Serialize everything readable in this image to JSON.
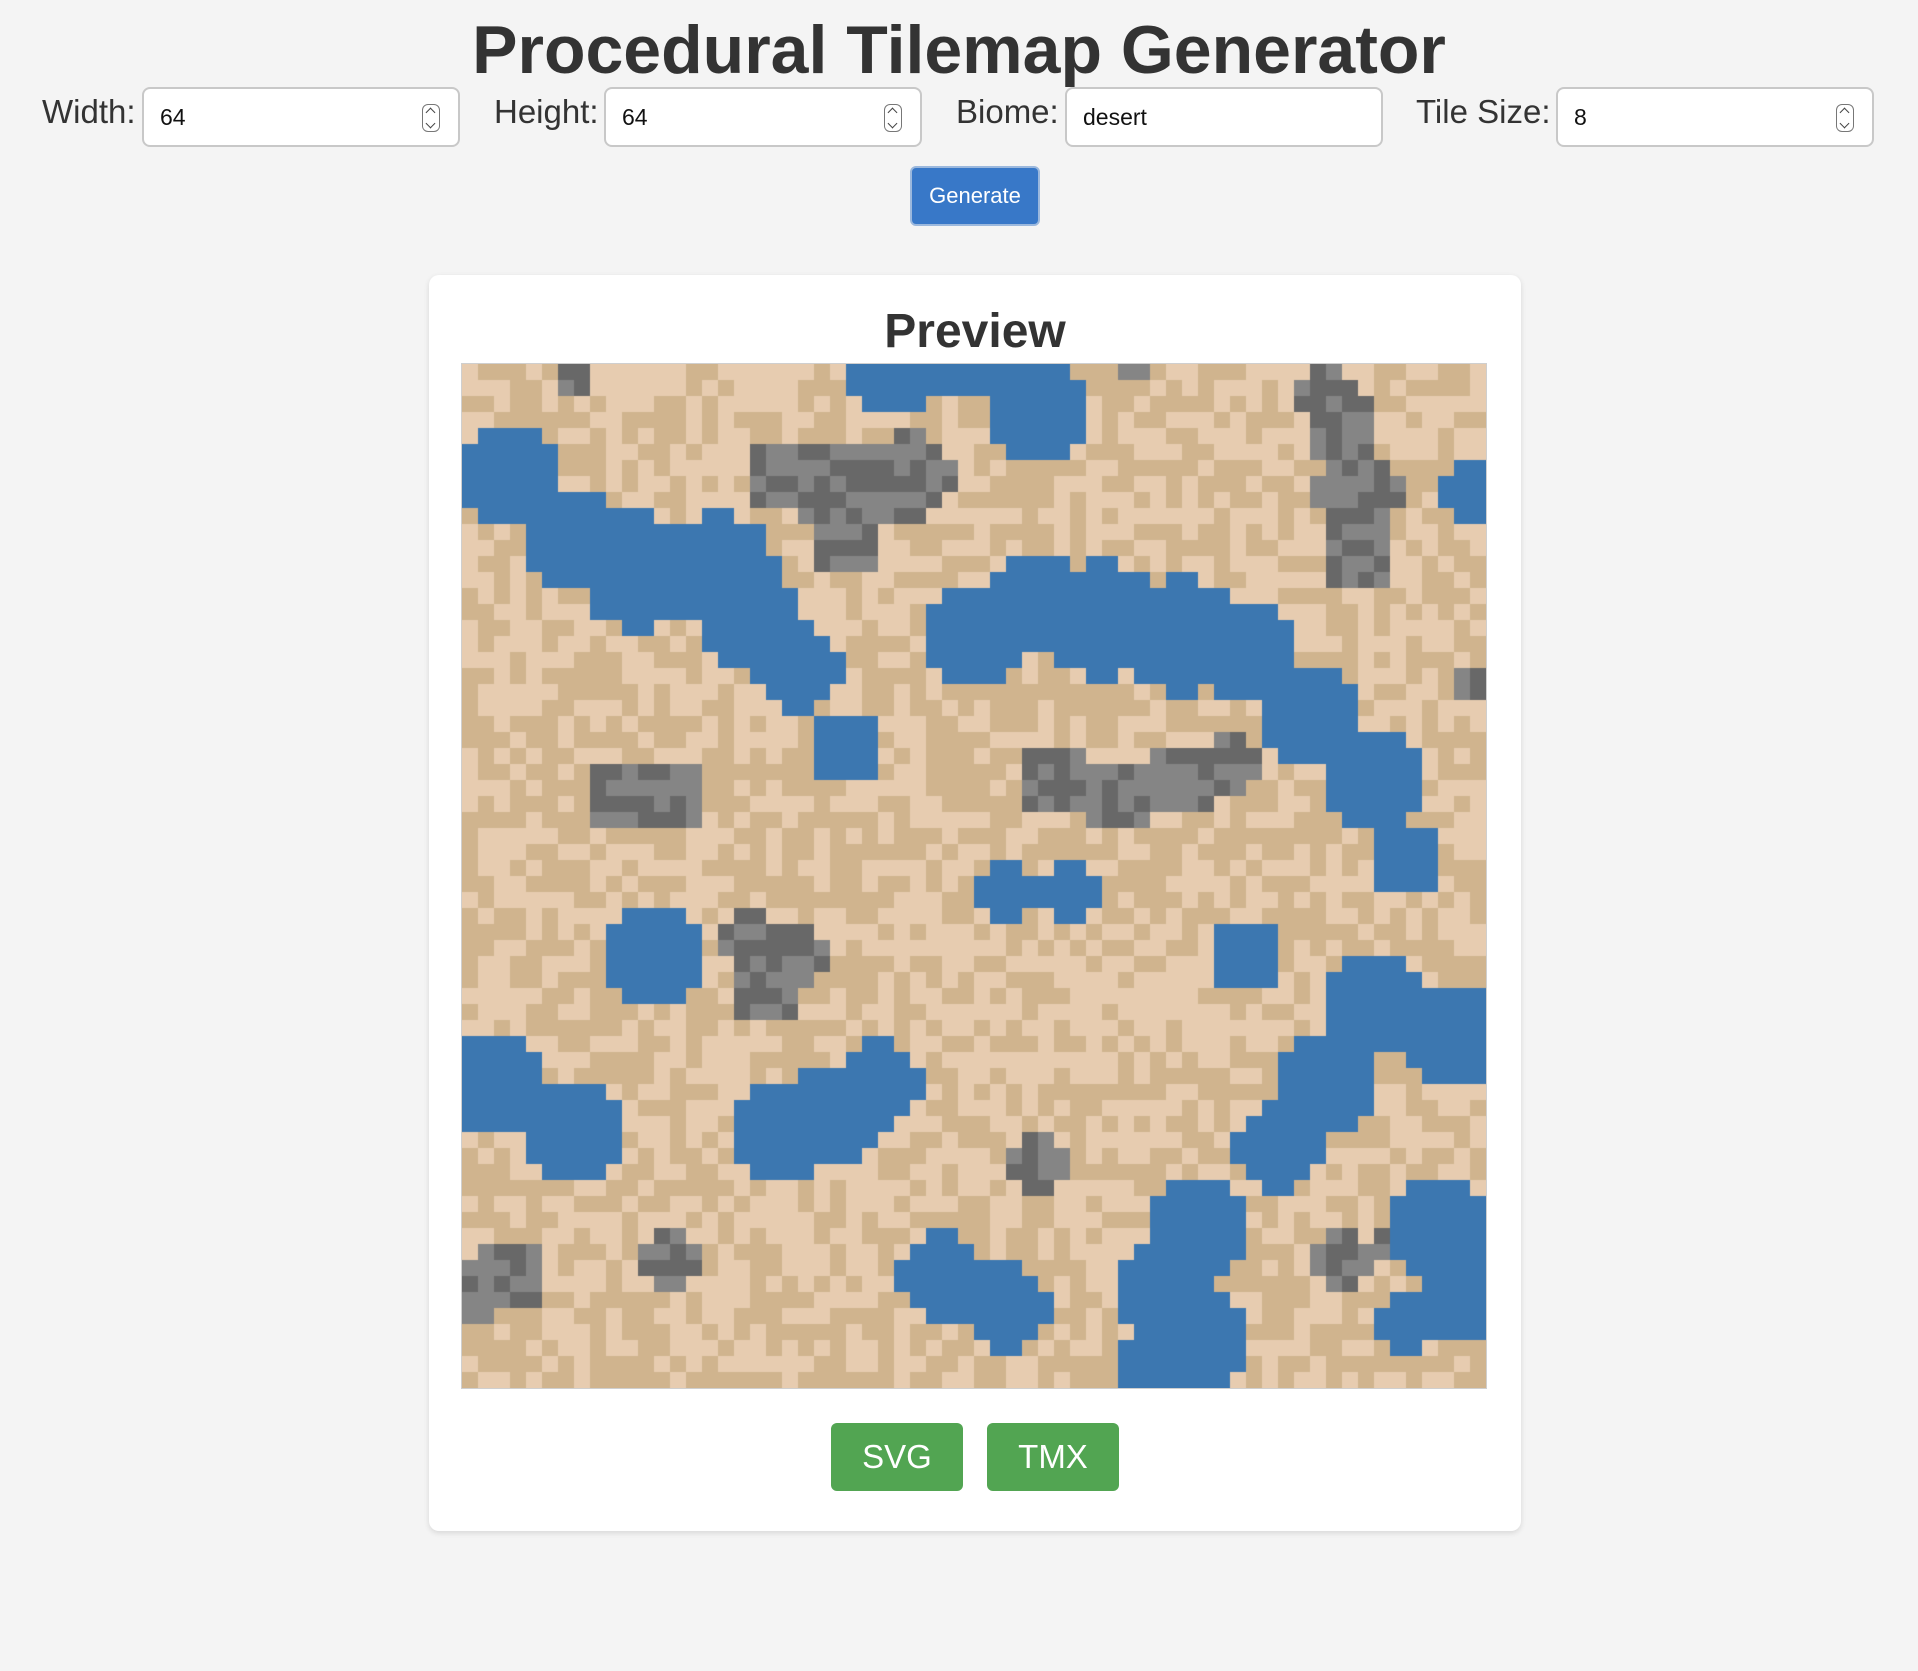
{
  "title": "Procedural Tilemap Generator",
  "controls": {
    "width": {
      "label": "Width:",
      "value": "64"
    },
    "height": {
      "label": "Height:",
      "value": "64"
    },
    "biome": {
      "label": "Biome:",
      "value": "desert"
    },
    "tile_size": {
      "label": "Tile Size:",
      "value": "8"
    },
    "generate_label": "Generate"
  },
  "preview": {
    "title": "Preview",
    "grid_columns": 64,
    "grid_rows": 64,
    "tile_colors": {
      "sand_light": "#e7ccb0",
      "sand_dark": "#d0b48e",
      "water": "#3c77b0",
      "rock_light": "#858585",
      "rock_dark": "#686868"
    }
  },
  "downloads": {
    "svg_label": "SVG",
    "tmx_label": "TMX"
  },
  "colors": {
    "primary_button": "#3878c8",
    "download_button": "#52a552",
    "background": "#f4f4f4"
  }
}
